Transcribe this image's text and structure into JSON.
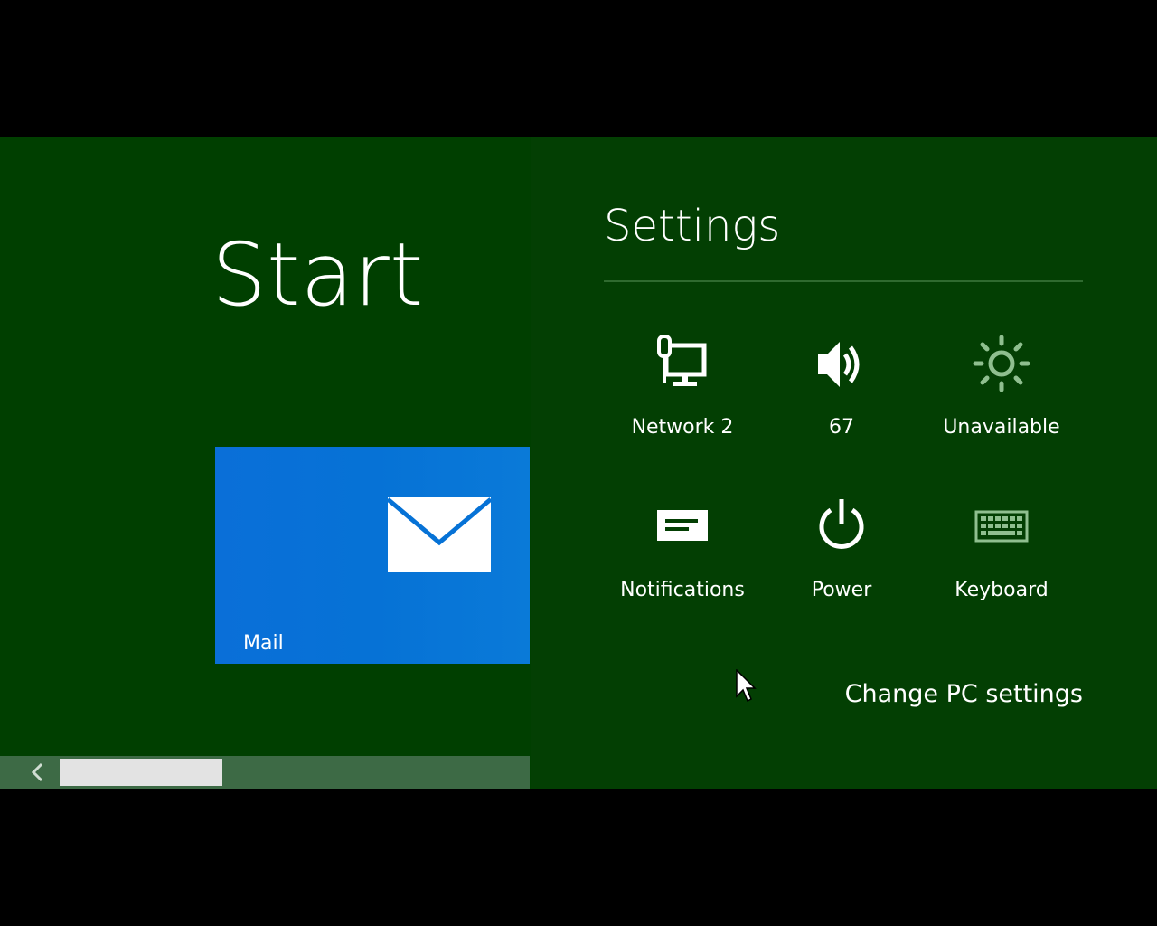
{
  "start": {
    "title": "Start",
    "tiles": [
      {
        "label": "Mail",
        "icon": "mail-icon",
        "color": "#0672d6"
      }
    ],
    "scrollbar": {
      "left_arrow": "‹",
      "position": 0.0
    }
  },
  "settings": {
    "title": "Settings",
    "items": [
      {
        "label": "Network  2",
        "icon": "network-icon"
      },
      {
        "label": "67",
        "icon": "volume-icon"
      },
      {
        "label": "Unavailable",
        "icon": "brightness-icon"
      },
      {
        "label": "Notifications",
        "icon": "notifications-icon"
      },
      {
        "label": "Power",
        "icon": "power-icon"
      },
      {
        "label": "Keyboard",
        "icon": "keyboard-icon"
      }
    ],
    "change_pc_settings": "Change PC settings"
  },
  "colors": {
    "background": "#003f00",
    "settings_pane": "#033f03",
    "tile_mail": "#0672d6",
    "scrollbar": "#3d6a45"
  }
}
